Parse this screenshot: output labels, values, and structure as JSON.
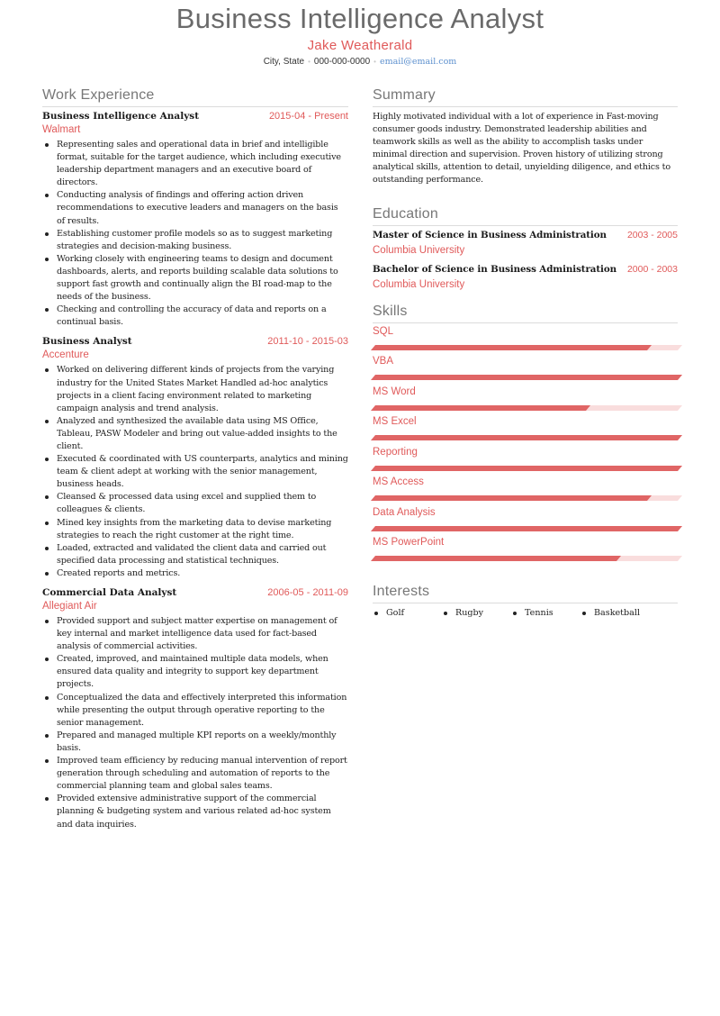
{
  "header": {
    "title": "Business Intelligence Analyst",
    "name": "Jake Weatherald",
    "location": "City, State",
    "phone": "000-000-0000",
    "email": "email@email.com",
    "separator": "•"
  },
  "colors": {
    "accent": "#e05a5a",
    "bar_fill": "#e06565",
    "bar_track": "#f9dddd",
    "heading": "#777777",
    "link": "#5b8fce"
  },
  "work": {
    "title": "Work Experience",
    "jobs": [
      {
        "title": "Business Intelligence Analyst",
        "dates": "2015-04 - Present",
        "company": "Walmart",
        "bullets": [
          "Representing sales and operational data in brief and intelligible format, suitable for the target audience, which including executive leadership department managers and an executive board of directors.",
          "Conducting analysis of findings and offering action driven recommendations to executive leaders and managers on the basis of results.",
          "Establishing customer profile models so as to suggest marketing strategies and decision-making business.",
          "Working closely with engineering teams to design and document dashboards, alerts, and reports building scalable data solutions to support fast growth and continually align the BI road-map to the needs of the business.",
          "Checking and controlling the accuracy of data and reports on a continual basis."
        ]
      },
      {
        "title": "Business Analyst",
        "dates": "2011-10 - 2015-03",
        "company": "Accenture",
        "bullets": [
          "Worked on delivering different kinds of projects from the varying industry for the United States Market Handled ad-hoc analytics projects in a client facing environment related to marketing campaign analysis and trend analysis.",
          "Analyzed and synthesized the available data using MS Office, Tableau, PASW Modeler and bring out value-added insights to the client.",
          "Executed & coordinated with US counterparts, analytics and mining team & client adept at working with the senior management, business heads.",
          "Cleansed & processed data using excel and supplied them to colleagues & clients.",
          "Mined key insights from the marketing data to devise marketing strategies to reach the right customer at the right time.",
          "Loaded, extracted and validated the client data and carried out specified data processing and statistical techniques.",
          "Created reports and metrics."
        ]
      },
      {
        "title": "Commercial Data Analyst",
        "dates": "2006-05 - 2011-09",
        "company": "Allegiant Air",
        "bullets": [
          "Provided support and subject matter expertise on management of key internal and market intelligence data used for fact-based analysis of commercial activities.",
          "Created, improved, and maintained multiple data models, when ensured data quality and integrity to support key department projects.",
          "Conceptualized the data and effectively interpreted this information while presenting the output through operative reporting to the senior management.",
          "Prepared and managed multiple KPI reports on a weekly/monthly basis.",
          "Improved team efficiency by reducing manual intervention of report generation through scheduling and automation of reports to the commercial planning team and global sales teams.",
          "Provided extensive administrative support of the commercial planning & budgeting system and various related ad-hoc system and data inquiries."
        ]
      }
    ]
  },
  "summary": {
    "title": "Summary",
    "text": "Highly motivated individual with a lot of experience in Fast-moving consumer goods industry. Demonstrated leadership abilities and teamwork skills as well as the ability to accomplish tasks under minimal direction and supervision. Proven history of utilizing strong analytical skills, attention to detail, unyielding diligence, and ethics to outstanding performance."
  },
  "education": {
    "title": "Education",
    "items": [
      {
        "degree": "Master of Science in Business Administration",
        "dates": "2003 - 2005",
        "school": "Columbia University"
      },
      {
        "degree": "Bachelor of Science in Business Administration",
        "dates": "2000 - 2003",
        "school": "Columbia University"
      }
    ]
  },
  "skills": {
    "title": "Skills",
    "items": [
      {
        "name": "SQL",
        "level": 0.9
      },
      {
        "name": "VBA",
        "level": 1.0
      },
      {
        "name": "MS Word",
        "level": 0.7
      },
      {
        "name": "MS Excel",
        "level": 1.0
      },
      {
        "name": "Reporting",
        "level": 1.0
      },
      {
        "name": "MS Access",
        "level": 0.9
      },
      {
        "name": "Data Analysis",
        "level": 1.0
      },
      {
        "name": "MS PowerPoint",
        "level": 0.8
      }
    ]
  },
  "interests": {
    "title": "Interests",
    "items": [
      "Golf",
      "Rugby",
      "Tennis",
      "Basketball"
    ]
  }
}
